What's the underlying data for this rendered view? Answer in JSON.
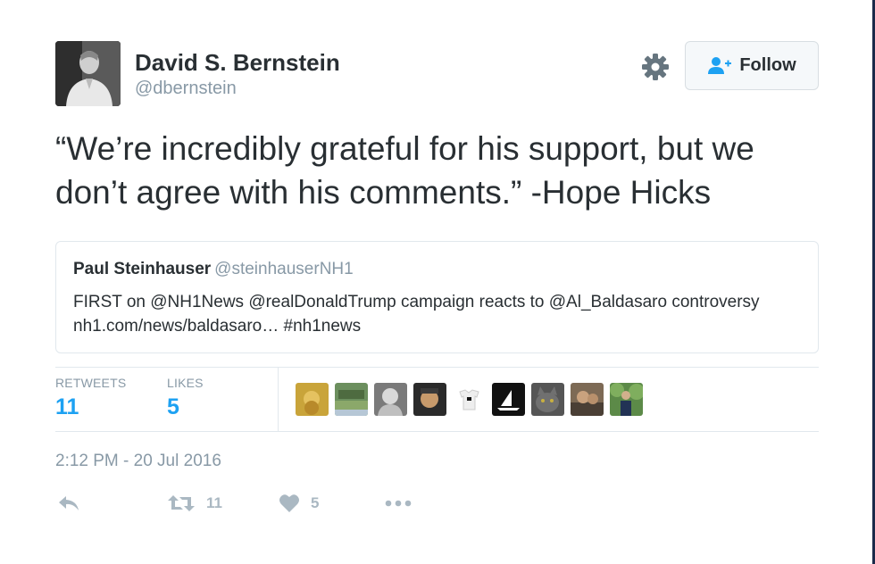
{
  "author": {
    "name": "David S. Bernstein",
    "handle": "@dbernstein",
    "avatar_icon": "person-photo"
  },
  "actions_top": {
    "settings_icon": "gear-icon",
    "follow_label": "Follow"
  },
  "tweet": {
    "text": "“We’re incredibly grateful for his support, but we don’t agree with his comments.” -Hope Hicks"
  },
  "quoted_tweet": {
    "name": "Paul Steinhauser",
    "handle": "@steinhauserNH1",
    "text": "FIRST on @NH1News @realDonaldTrump campaign reacts to @Al_Baldasaro controversy nh1.com/news/baldasaro… #nh1news"
  },
  "stats": {
    "retweets_label": "RETWEETS",
    "retweets_value": "11",
    "likes_label": "LIKES",
    "likes_value": "5"
  },
  "likers": [
    {
      "name": "liker-1"
    },
    {
      "name": "liker-2"
    },
    {
      "name": "liker-3"
    },
    {
      "name": "liker-4"
    },
    {
      "name": "liker-5"
    },
    {
      "name": "liker-6"
    },
    {
      "name": "liker-7"
    },
    {
      "name": "liker-8"
    },
    {
      "name": "liker-9"
    }
  ],
  "timestamp": "2:12 PM - 20 Jul 2016",
  "footer_actions": {
    "reply_icon": "reply-icon",
    "retweet_icon": "retweet-icon",
    "retweet_count": "11",
    "like_icon": "heart-icon",
    "like_count": "5",
    "more_icon": "more-icon"
  },
  "colors": {
    "link_blue": "#1da1f2",
    "text": "#292f33",
    "muted": "#8899a6",
    "border": "#e1e8ed"
  }
}
